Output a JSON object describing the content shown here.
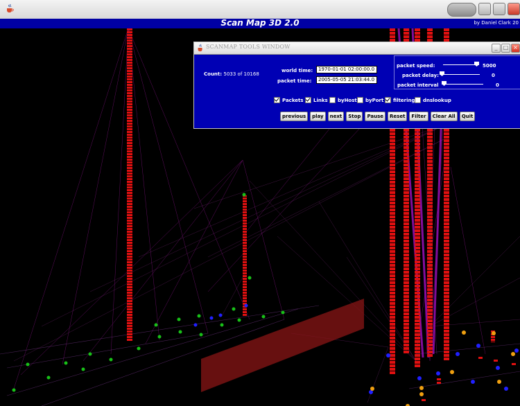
{
  "app": {
    "title": "Scan Map 3D 2.0",
    "credit": "by Daniel Clark 20",
    "icon": "java-cup-icon"
  },
  "tools_window": {
    "title": "SCANMAP TOOLS WINDOW",
    "count_label": "Count:",
    "count_value": "5033 of 10168",
    "world_time_label": "world time:",
    "world_time_value": "1970-01-01 02:00:00.0",
    "packet_time_label": "packet time:",
    "packet_time_value": "2005-05-05 21:03:44.0",
    "packet_speed_label": "packet speed:",
    "packet_speed_value": "5000",
    "packet_delay_label": "packet delay:",
    "packet_delay_value": "0",
    "packet_interval_label": "packet interval",
    "packet_interval_value": "0",
    "sliders": {
      "speed_fraction": 1.0,
      "delay_fraction": 0.0,
      "interval_fraction": 0.0
    },
    "checkboxes": [
      {
        "label": "Packets",
        "checked": true
      },
      {
        "label": "Links",
        "checked": true
      },
      {
        "label": "byHost",
        "checked": false
      },
      {
        "label": "byPort",
        "checked": false
      },
      {
        "label": "filtering",
        "checked": true
      },
      {
        "label": "dnslookup",
        "checked": false
      }
    ],
    "buttons": [
      "previous",
      "play",
      "next",
      "Stop",
      "Pause",
      "Reset",
      "Filter",
      "Clear All",
      "Quit"
    ]
  },
  "colors": {
    "banner": "#0000a4",
    "tools_bg": "#0000b4",
    "packet_red": "#e01010",
    "link_magenta": "#c020c0"
  }
}
